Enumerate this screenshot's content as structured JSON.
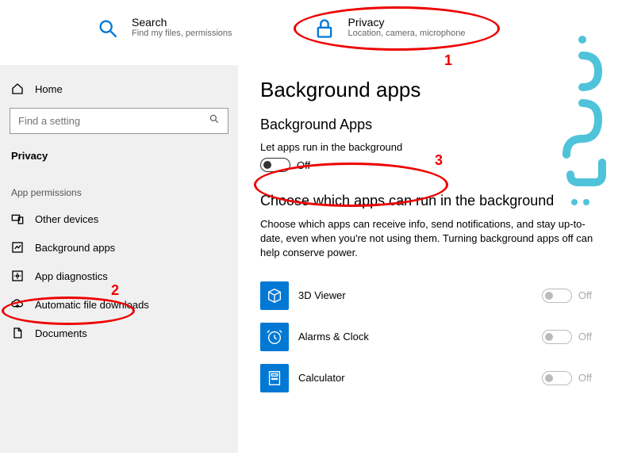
{
  "top": {
    "search": {
      "title": "Search",
      "sub": "Find my files, permissions"
    },
    "privacy": {
      "title": "Privacy",
      "sub": "Location, camera, microphone"
    }
  },
  "sidebar": {
    "home": "Home",
    "search_placeholder": "Find a setting",
    "section": "Privacy",
    "group": "App permissions",
    "items": {
      "other_devices": "Other devices",
      "background_apps": "Background apps",
      "app_diagnostics": "App diagnostics",
      "auto_downloads": "Automatic file downloads",
      "documents": "Documents"
    }
  },
  "main": {
    "title": "Background apps",
    "heading1": "Background Apps",
    "toggle_label": "Let apps run in the background",
    "toggle_state": "Off",
    "heading2": "Choose which apps can run in the background",
    "desc": "Choose which apps can receive info, send notifications, and stay up-to-date, even when you're not using them. Turning background apps off can help conserve power.",
    "apps": {
      "viewer3d": {
        "name": "3D Viewer",
        "state": "Off"
      },
      "alarms": {
        "name": "Alarms & Clock",
        "state": "Off"
      },
      "calculator": {
        "name": "Calculator",
        "state": "Off"
      }
    }
  },
  "annotations": {
    "n1": "1",
    "n2": "2",
    "n3": "3"
  }
}
